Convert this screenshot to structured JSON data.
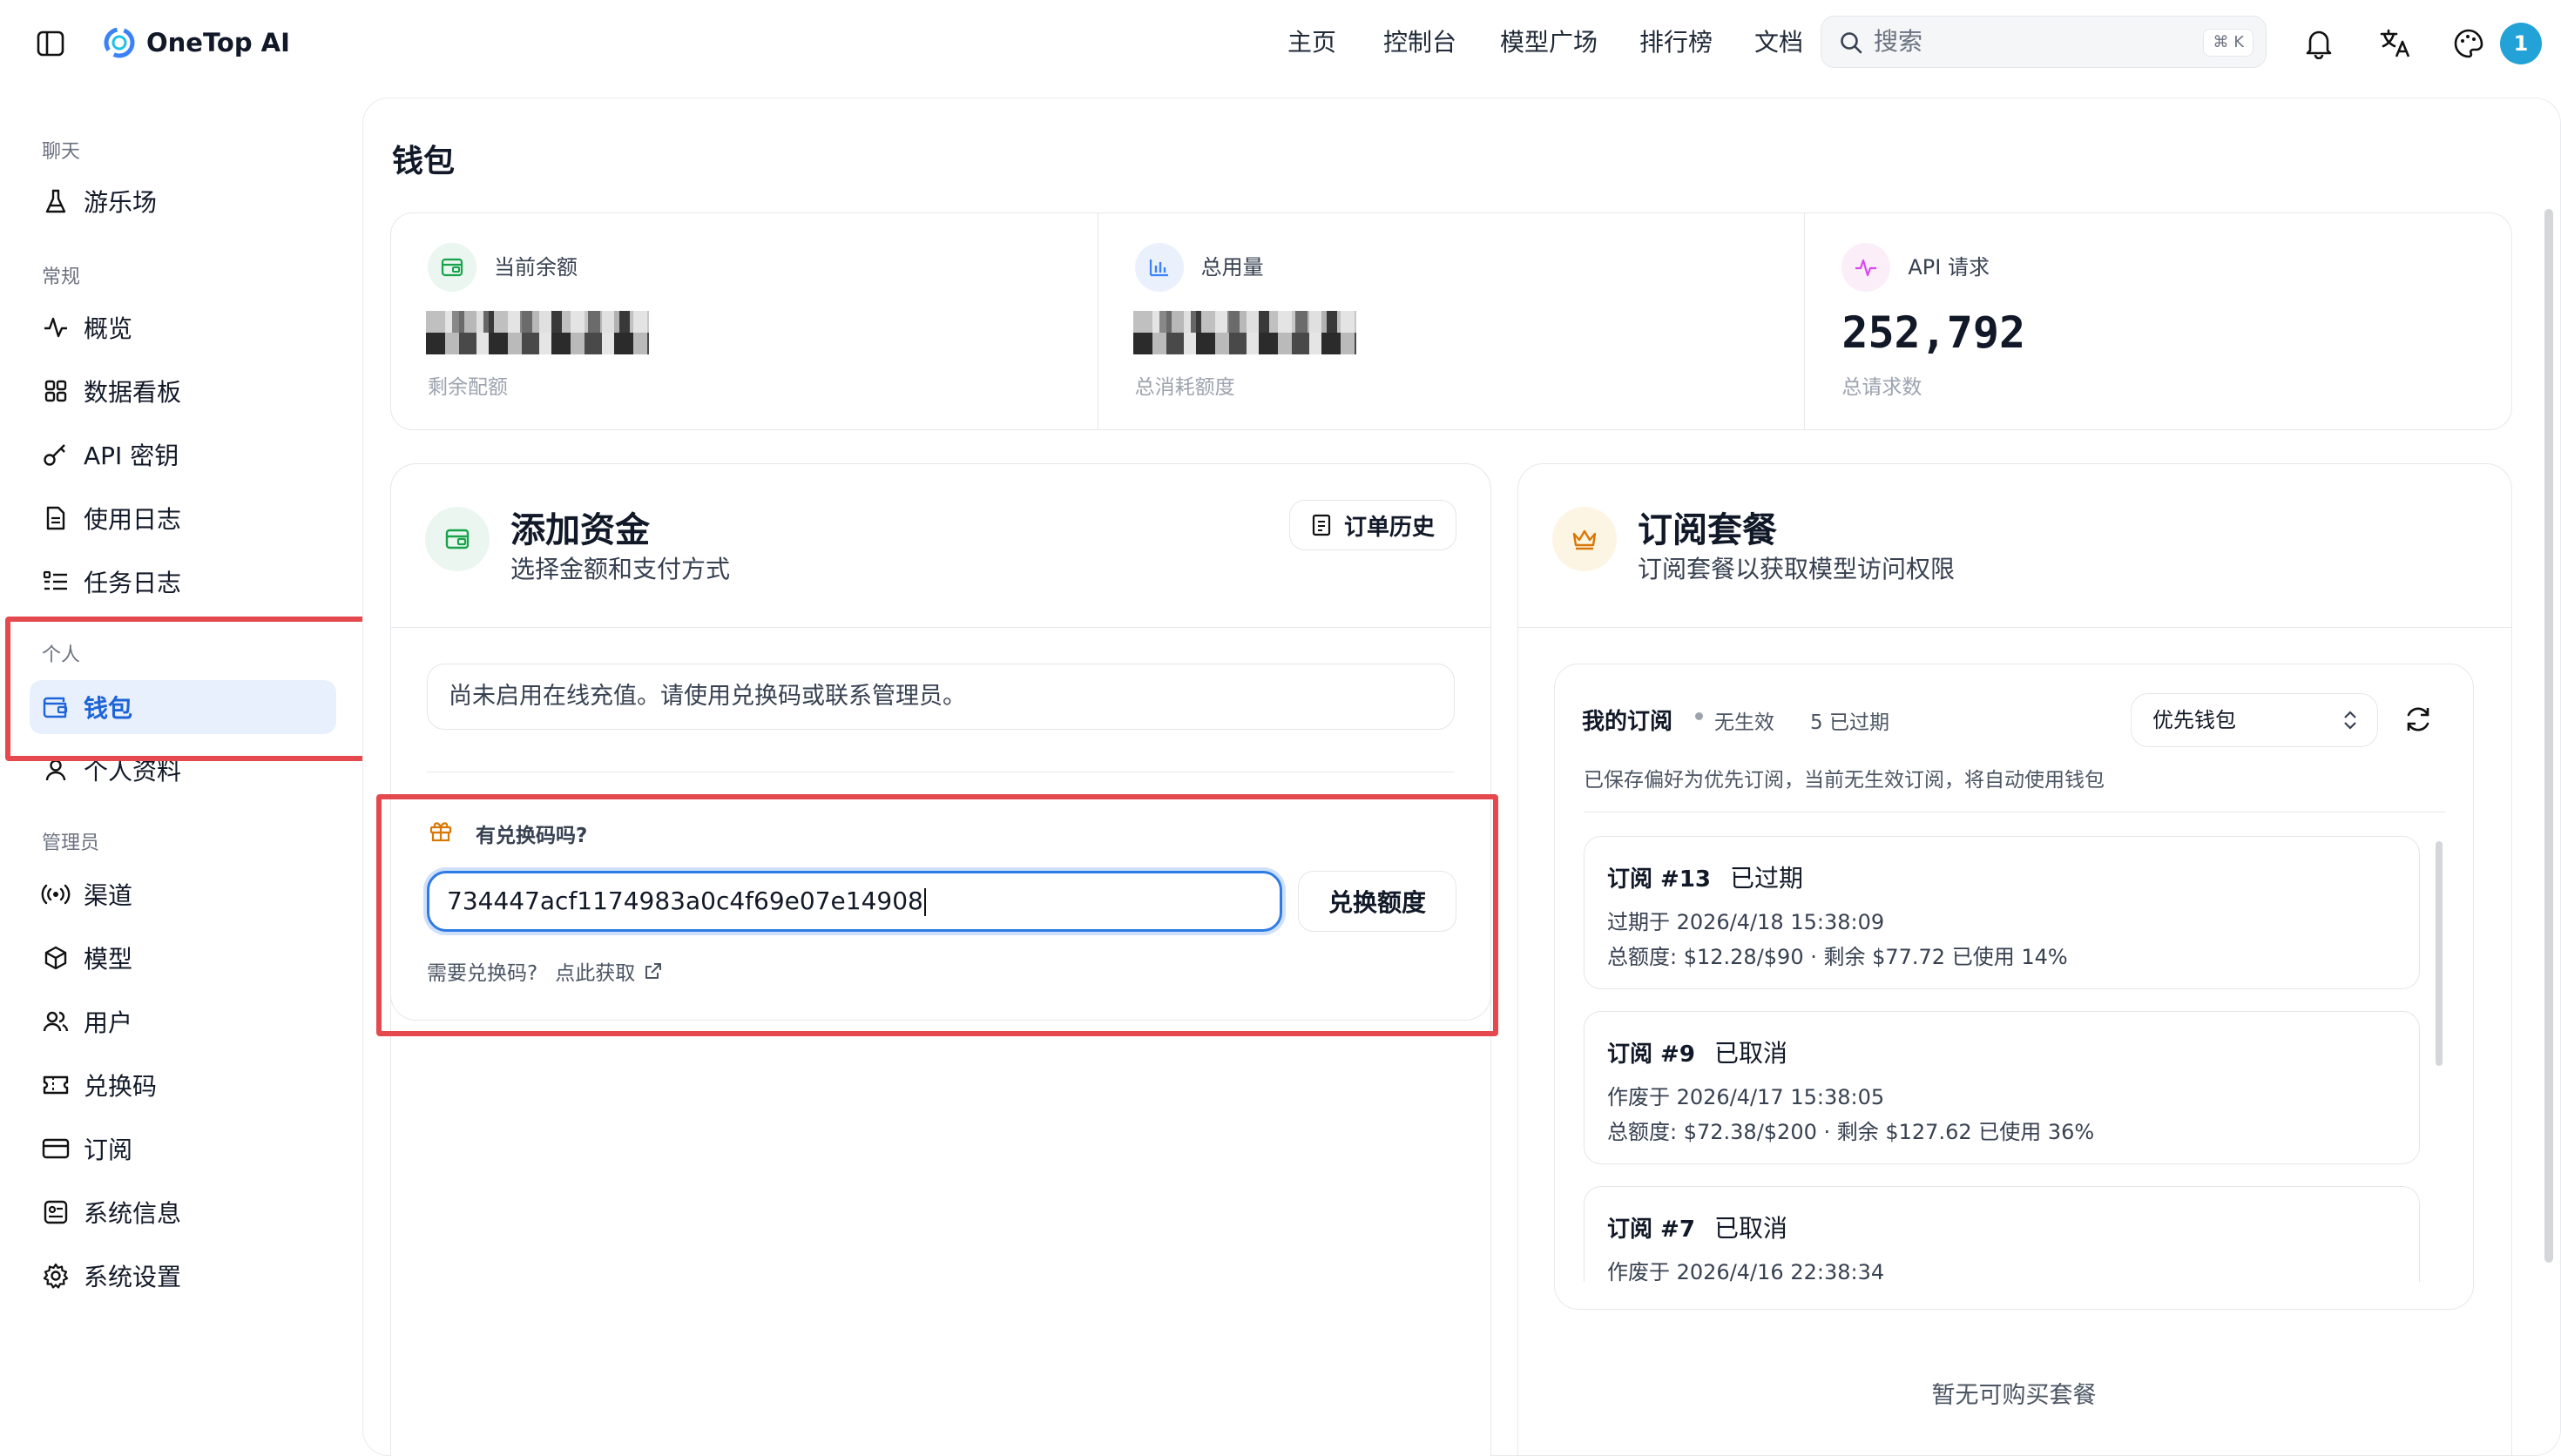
{
  "app": {
    "brand": "OneTop AI"
  },
  "nav": {
    "home": "主页",
    "console": "控制台",
    "models": "模型广场",
    "ranking": "排行榜",
    "docs": "文档"
  },
  "search": {
    "placeholder": "搜索",
    "shortcut": "⌘ K"
  },
  "user": {
    "avatar": "1"
  },
  "sidebar": {
    "groups": {
      "chat": "聊天",
      "general": "常规",
      "personal": "个人",
      "admin": "管理员"
    },
    "items": {
      "playground": "游乐场",
      "overview": "概览",
      "dashboard": "数据看板",
      "api_keys": "API 密钥",
      "usage_logs": "使用日志",
      "task_logs": "任务日志",
      "wallet": "钱包",
      "profile": "个人资料",
      "channels": "渠道",
      "models": "模型",
      "users": "用户",
      "redeem_codes": "兑换码",
      "subscriptions": "订阅",
      "system_info": "系统信息",
      "system_settings": "系统设置"
    }
  },
  "page": {
    "title": "钱包"
  },
  "stats": {
    "balance": {
      "label": "当前余额",
      "sub": "剩余配额"
    },
    "usage": {
      "label": "总用量",
      "sub": "总消耗额度"
    },
    "requests": {
      "label": "API 请求",
      "value": "252,792",
      "sub": "总请求数"
    }
  },
  "add_funds": {
    "title": "添加资金",
    "subtitle": "选择金额和支付方式",
    "history_button": "订单历史",
    "notice": "尚未启用在线充值。请使用兑换码或联系管理员。",
    "redeem_label": "有兑换码吗?",
    "redeem_value": "734447acf1174983a0c4f69e07e14908",
    "redeem_button": "兑换额度",
    "help_text": "需要兑换码?",
    "help_link": "点此获取"
  },
  "subscription": {
    "title": "订阅套餐",
    "subtitle": "订阅套餐以获取模型访问权限",
    "my_subs": "我的订阅",
    "active_status": "无生效",
    "expired_count": "5 已过期",
    "billing_pref": "优先钱包",
    "info": "已保存偏好为优先订阅，当前无生效订阅，将自动使用钱包",
    "items": [
      {
        "title": "订阅 #13",
        "status": "已过期",
        "line1": "过期于 2026/4/18 15:38:09",
        "line2": "总额度: $12.28/$90 · 剩余 $77.72 已使用 14%"
      },
      {
        "title": "订阅 #9",
        "status": "已取消",
        "line1": "作废于 2026/4/17 15:38:05",
        "line2": "总额度: $72.38/$200 · 剩余 $127.62 已使用 36%"
      },
      {
        "title": "订阅 #7",
        "status": "已取消",
        "line1": "作废于 2026/4/16 22:38:34"
      }
    ],
    "no_plans": "暂无可购买套餐"
  },
  "colors": {
    "accent": "#1d64d8",
    "highlight_red": "#e5484d",
    "green_icon_bg": "#eaf6ef",
    "blue_icon_bg": "#eaf1fc",
    "pink_icon_bg": "#fbeef8",
    "gold_icon_bg": "#fdf5e4"
  }
}
